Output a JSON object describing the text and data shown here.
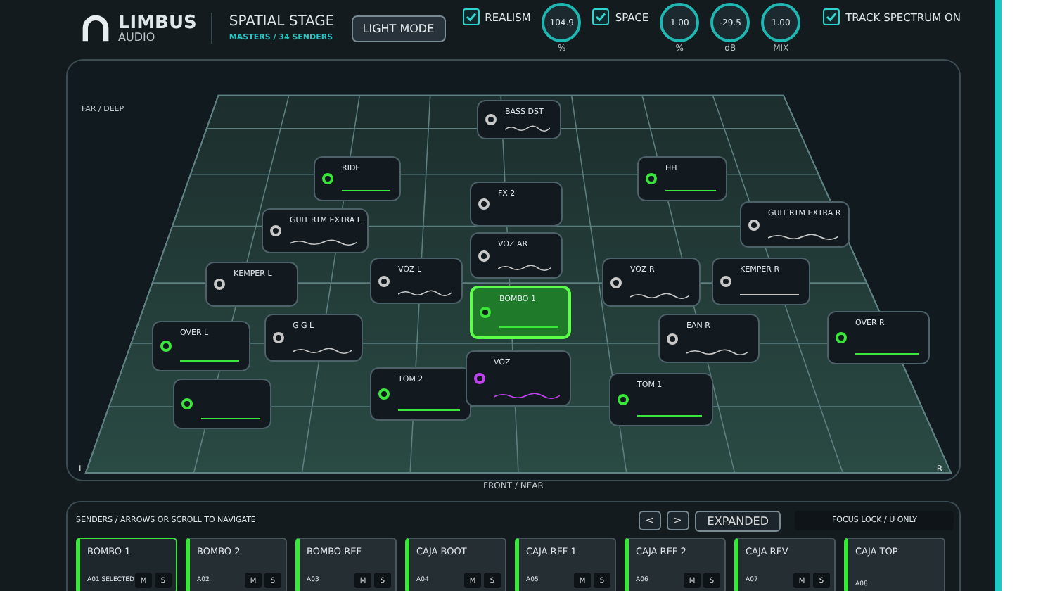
{
  "header": {
    "brand": "LIMBUS",
    "brand_sub": "AUDIO",
    "title": "SPATIAL STAGE",
    "subtitle": "MASTERS / 34 SENDERS",
    "mode_button": "LIGHT MODE",
    "controls": [
      {
        "kind": "checkbox",
        "label": "REALISM",
        "checked": true
      },
      {
        "kind": "knob",
        "value": "104.9",
        "unit": "%"
      },
      {
        "kind": "checkbox",
        "label": "SPACE",
        "checked": true
      },
      {
        "kind": "knob",
        "value": "1.00",
        "unit": "%"
      },
      {
        "kind": "knob",
        "value": "-29.5",
        "unit": "dB"
      },
      {
        "kind": "knob",
        "value": "1.00",
        "unit": "MIX"
      },
      {
        "kind": "checkbox",
        "label": "TRACK SPECTRUM ON",
        "checked": true
      }
    ]
  },
  "stage": {
    "far_label": "FAR / DEEP",
    "near_label": "FRONT / NEAR",
    "left_label": "L",
    "right_label": "R",
    "nodes": [
      {
        "label": "BASS DST",
        "color": "#c8c8c8",
        "kind": "wave",
        "selected": false
      },
      {
        "label": "RIDE",
        "color": "#39e639",
        "kind": "bar",
        "selected": false
      },
      {
        "label": "GUIT RTM EXTRA L",
        "color": "#c8c8c8",
        "kind": "wave",
        "selected": false
      },
      {
        "label": "HH",
        "color": "#39e639",
        "kind": "bar",
        "selected": false
      },
      {
        "label": "GUIT RTM EXTRA R",
        "color": "#c8c8c8",
        "kind": "wave",
        "selected": false
      },
      {
        "label": "FX 2",
        "color": "#c8c8c8",
        "kind": "plain",
        "selected": false
      },
      {
        "label": "VOZ AR",
        "color": "#c8c8c8",
        "kind": "wave",
        "selected": false
      },
      {
        "label": "KEMPER L",
        "color": "#c8c8c8",
        "kind": "plain",
        "selected": false
      },
      {
        "label": "G G L",
        "color": "#c8c8c8",
        "kind": "wave",
        "selected": false
      },
      {
        "label": "VOZ L",
        "color": "#c8c8c8",
        "kind": "wave",
        "selected": false
      },
      {
        "label": "KEMPER R",
        "color": "#c8c8c8",
        "kind": "bar",
        "selected": false
      },
      {
        "label": "EAN R",
        "color": "#c8c8c8",
        "kind": "wave",
        "selected": false
      },
      {
        "label": "VOZ R",
        "color": "#c8c8c8",
        "kind": "wave",
        "selected": false
      },
      {
        "color": "#39e639",
        "kind": "bar",
        "selected": false
      },
      {
        "label": "OVER L",
        "color": "#39e639",
        "kind": "bar",
        "selected": false
      },
      {
        "label": "BOMBO 1",
        "color": "#39e639",
        "kind": "bar",
        "selected": true
      },
      {
        "label": "TOM 2",
        "color": "#39e639",
        "kind": "bar",
        "selected": false
      },
      {
        "label": "VOZ",
        "color": "#c040f0",
        "kind": "wave",
        "selected": false
      },
      {
        "label": "TOM 1",
        "color": "#39e639",
        "kind": "bar",
        "selected": false
      },
      {
        "label": "OVER R",
        "color": "#39e639",
        "kind": "bar",
        "selected": false
      }
    ]
  },
  "senders": {
    "title": "SENDERS / ARROWS OR SCROLL TO NAVIGATE",
    "prev": "<",
    "next": ">",
    "view_button": "EXPANDED",
    "focus_field": "FOCUS LOCK / U ONLY",
    "cards": [
      {
        "name": "BOMBO 1",
        "code": "A01 SELECTED",
        "selected": true,
        "buttons": [
          "M",
          "S"
        ]
      },
      {
        "name": "BOMBO 2",
        "code": "A02",
        "selected": false,
        "buttons": [
          "M",
          "S"
        ]
      },
      {
        "name": "BOMBO REF",
        "code": "A03",
        "selected": false,
        "buttons": [
          "M",
          "S"
        ]
      },
      {
        "name": "CAJA BOOT",
        "code": "A04",
        "selected": false,
        "buttons": [
          "M",
          "S"
        ]
      },
      {
        "name": "CAJA REF 1",
        "code": "A05",
        "selected": false,
        "buttons": [
          "M",
          "S"
        ]
      },
      {
        "name": "CAJA REF 2",
        "code": "A06",
        "selected": false,
        "buttons": [
          "M",
          "S"
        ]
      },
      {
        "name": "CAJA REV",
        "code": "A07",
        "selected": false,
        "buttons": [
          "M",
          "S"
        ]
      },
      {
        "name": "CAJA TOP",
        "code": "A08",
        "selected": false
      }
    ]
  }
}
